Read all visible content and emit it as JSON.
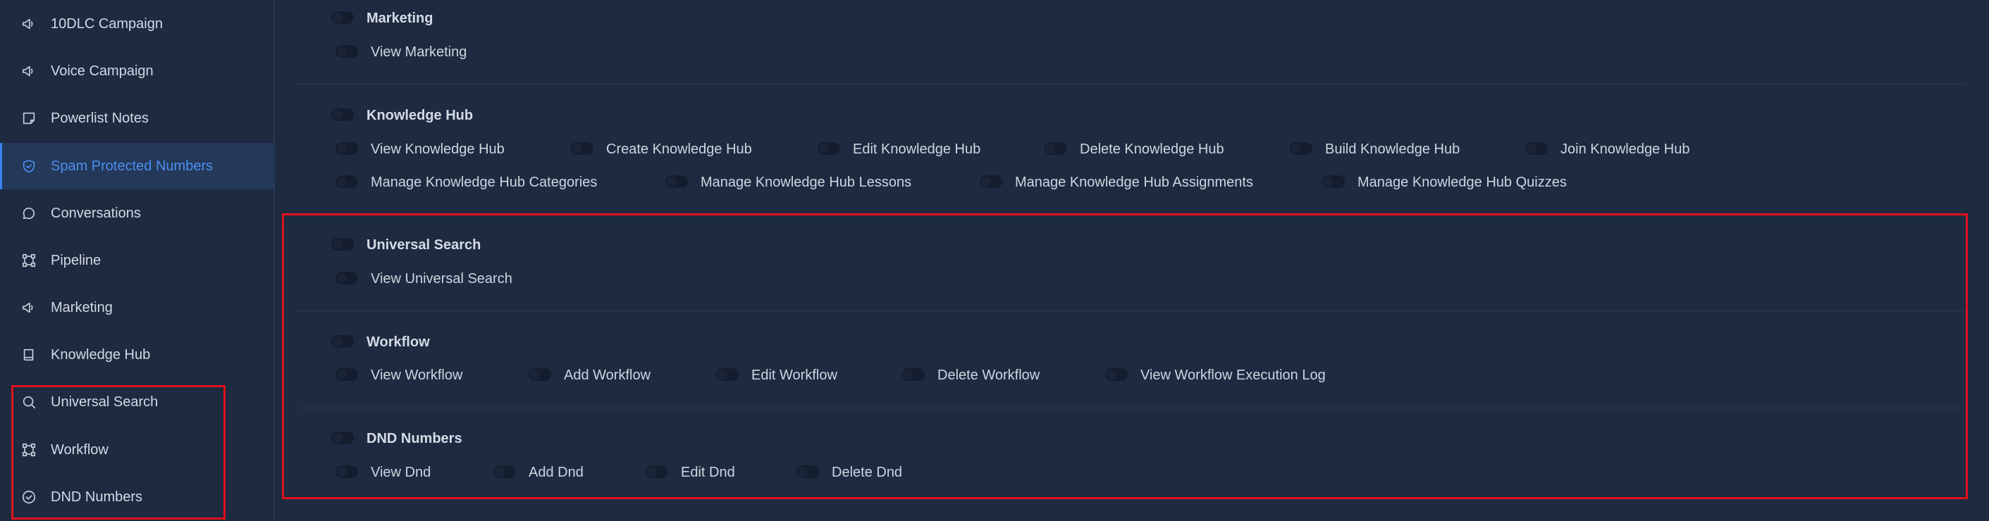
{
  "sidebar": {
    "items": [
      {
        "label": "10DLC Campaign",
        "icon": "megaphone-icon"
      },
      {
        "label": "Voice Campaign",
        "icon": "megaphone-icon"
      },
      {
        "label": "Powerlist Notes",
        "icon": "note-icon"
      },
      {
        "label": "Spam Protected Numbers",
        "icon": "shield-check-icon",
        "active": true
      },
      {
        "label": "Conversations",
        "icon": "chat-bubble-icon"
      },
      {
        "label": "Pipeline",
        "icon": "pipeline-icon"
      },
      {
        "label": "Marketing",
        "icon": "megaphone-icon"
      },
      {
        "label": "Knowledge Hub",
        "icon": "book-icon"
      },
      {
        "label": "Universal Search",
        "icon": "search-icon"
      },
      {
        "label": "Workflow",
        "icon": "workflow-icon"
      },
      {
        "label": "DND Numbers",
        "icon": "check-circle-icon"
      }
    ]
  },
  "sections": {
    "marketing": {
      "title": "Marketing",
      "perms": [
        "View Marketing"
      ]
    },
    "knowledge_hub": {
      "title": "Knowledge Hub",
      "perms": [
        "View Knowledge Hub",
        "Create Knowledge Hub",
        "Edit Knowledge Hub",
        "Delete Knowledge Hub",
        "Build Knowledge Hub",
        "Join Knowledge Hub"
      ],
      "perms2": [
        "Manage Knowledge Hub Categories",
        "Manage Knowledge Hub Lessons",
        "Manage Knowledge Hub Assignments",
        "Manage Knowledge Hub Quizzes"
      ]
    },
    "universal_search": {
      "title": "Universal Search",
      "perms": [
        "View Universal Search"
      ]
    },
    "workflow": {
      "title": "Workflow",
      "perms": [
        "View Workflow",
        "Add Workflow",
        "Edit Workflow",
        "Delete Workflow",
        "View Workflow Execution Log"
      ]
    },
    "dnd_numbers": {
      "title": "DND Numbers",
      "perms": [
        "View Dnd",
        "Add Dnd",
        "Edit Dnd",
        "Delete Dnd"
      ]
    }
  },
  "colors": {
    "background": "#1d2a40",
    "active_accent": "#3b82f6",
    "highlight_border": "#e0111c"
  }
}
